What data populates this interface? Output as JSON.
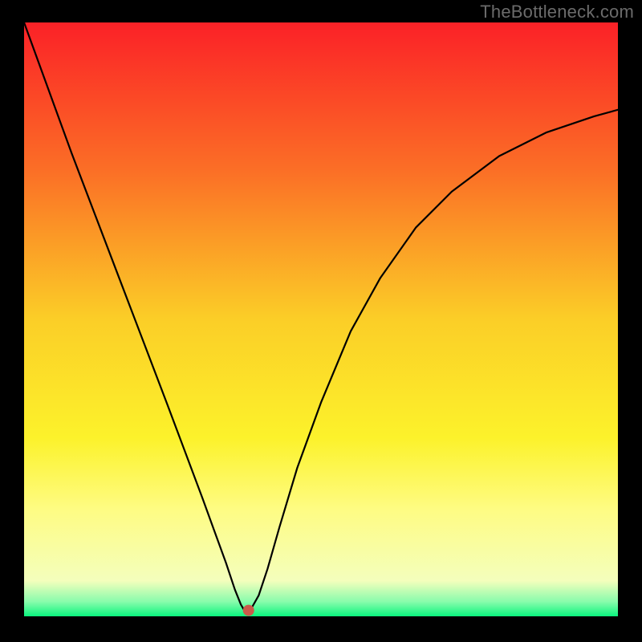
{
  "watermark": "TheBottleneck.com",
  "chart_data": {
    "type": "line",
    "title": "",
    "xlabel": "",
    "ylabel": "",
    "xlim": [
      0,
      100
    ],
    "ylim": [
      0,
      100
    ],
    "background_gradient": {
      "stops": [
        {
          "offset": 0.0,
          "color": "#fb2127"
        },
        {
          "offset": 0.25,
          "color": "#fb6f26"
        },
        {
          "offset": 0.5,
          "color": "#fbce27"
        },
        {
          "offset": 0.7,
          "color": "#fcf22b"
        },
        {
          "offset": 0.82,
          "color": "#fefc83"
        },
        {
          "offset": 0.94,
          "color": "#f4febc"
        },
        {
          "offset": 0.975,
          "color": "#8afcac"
        },
        {
          "offset": 1.0,
          "color": "#0af57e"
        }
      ]
    },
    "curve": {
      "x": [
        0,
        4,
        8,
        12,
        16,
        20,
        24,
        27,
        30,
        32,
        34,
        35.5,
        36.5,
        37.2,
        38.2,
        39.5,
        41,
        43,
        46,
        50,
        55,
        60,
        66,
        72,
        80,
        88,
        96,
        100
      ],
      "y": [
        100,
        89,
        78,
        67.5,
        57,
        46.5,
        36,
        28,
        20,
        14.5,
        9,
        4.5,
        2.0,
        0.8,
        1.2,
        3.5,
        8,
        15,
        25,
        36,
        48,
        57,
        65.5,
        71.5,
        77.5,
        81.5,
        84.2,
        85.3
      ]
    },
    "marker": {
      "x": 37.8,
      "y": 1.0,
      "color": "#cb5a4a",
      "radius_px": 7
    }
  }
}
